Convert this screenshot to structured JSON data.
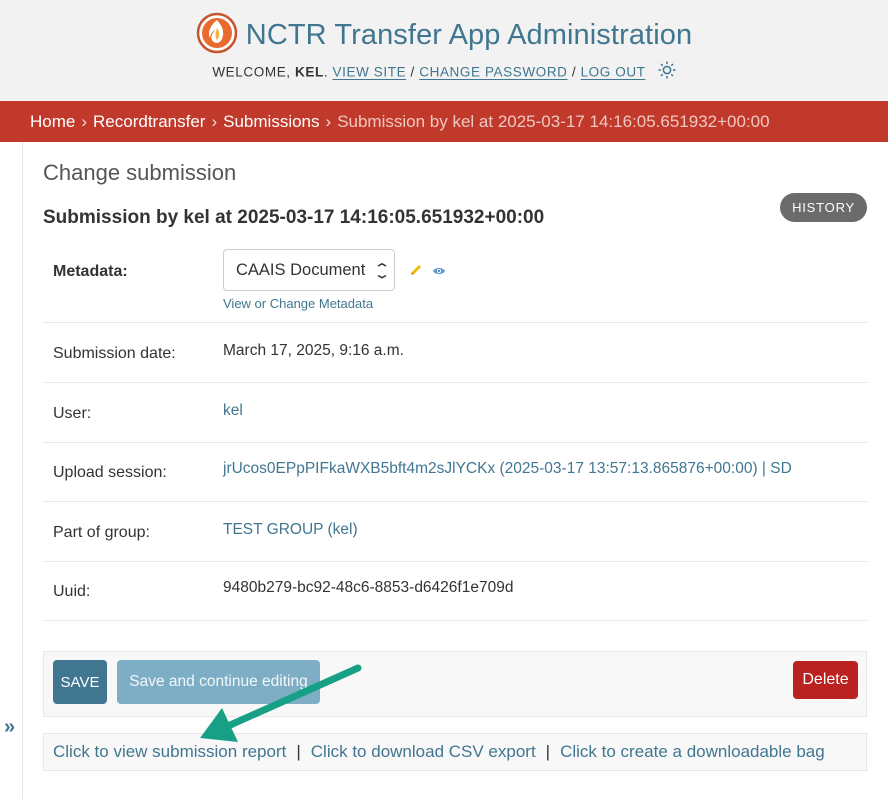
{
  "header": {
    "title": "NCTR Transfer App Administration",
    "welcome_prefix": "WELCOME, ",
    "username": "KEL",
    "view_site": "VIEW SITE",
    "change_password": "CHANGE PASSWORD",
    "log_out": "LOG OUT",
    "slash": " / "
  },
  "breadcrumbs": {
    "home": "Home",
    "app": "Recordtransfer",
    "model": "Submissions",
    "current": "Submission by kel at 2025-03-17 14:16:05.651932+00:00",
    "sep": "›"
  },
  "sidebar": {
    "toggle": "»"
  },
  "main": {
    "heading": "Change submission",
    "object_title": "Submission by kel at 2025-03-17 14:16:05.651932+00:00",
    "history": "HISTORY"
  },
  "form": {
    "metadata": {
      "label": "Metadata:",
      "selected": "CAAIS Document",
      "link": "View or Change Metadata"
    },
    "submission_date": {
      "label": "Submission date:",
      "value": "March 17, 2025, 9:16 a.m."
    },
    "user": {
      "label": "User:",
      "value": "kel"
    },
    "upload_session": {
      "label": "Upload session:",
      "value": "jrUcos0EPpPIFkaWXB5bft4m2sJlYCKx (2025-03-17 13:57:13.865876+00:00) | SD"
    },
    "part_of_group": {
      "label": "Part of group:",
      "value": "TEST GROUP (kel)"
    },
    "uuid": {
      "label": "Uuid:",
      "value": "9480b279-bc92-48c6-8853-d6426f1e709d"
    }
  },
  "actions": {
    "save": "SAVE",
    "save_continue": "Save and continue editing",
    "delete": "Delete"
  },
  "links": {
    "report": "Click to view submission report",
    "csv": "Click to download CSV export",
    "bag": "Click to create a downloadable bag",
    "pipe": "|"
  },
  "colors": {
    "header_bg": "#f2f2f2",
    "brand": "#417690",
    "breadcrumb_bg": "#c0392b",
    "delete": "#ba2121",
    "arrow": "#17a086"
  }
}
